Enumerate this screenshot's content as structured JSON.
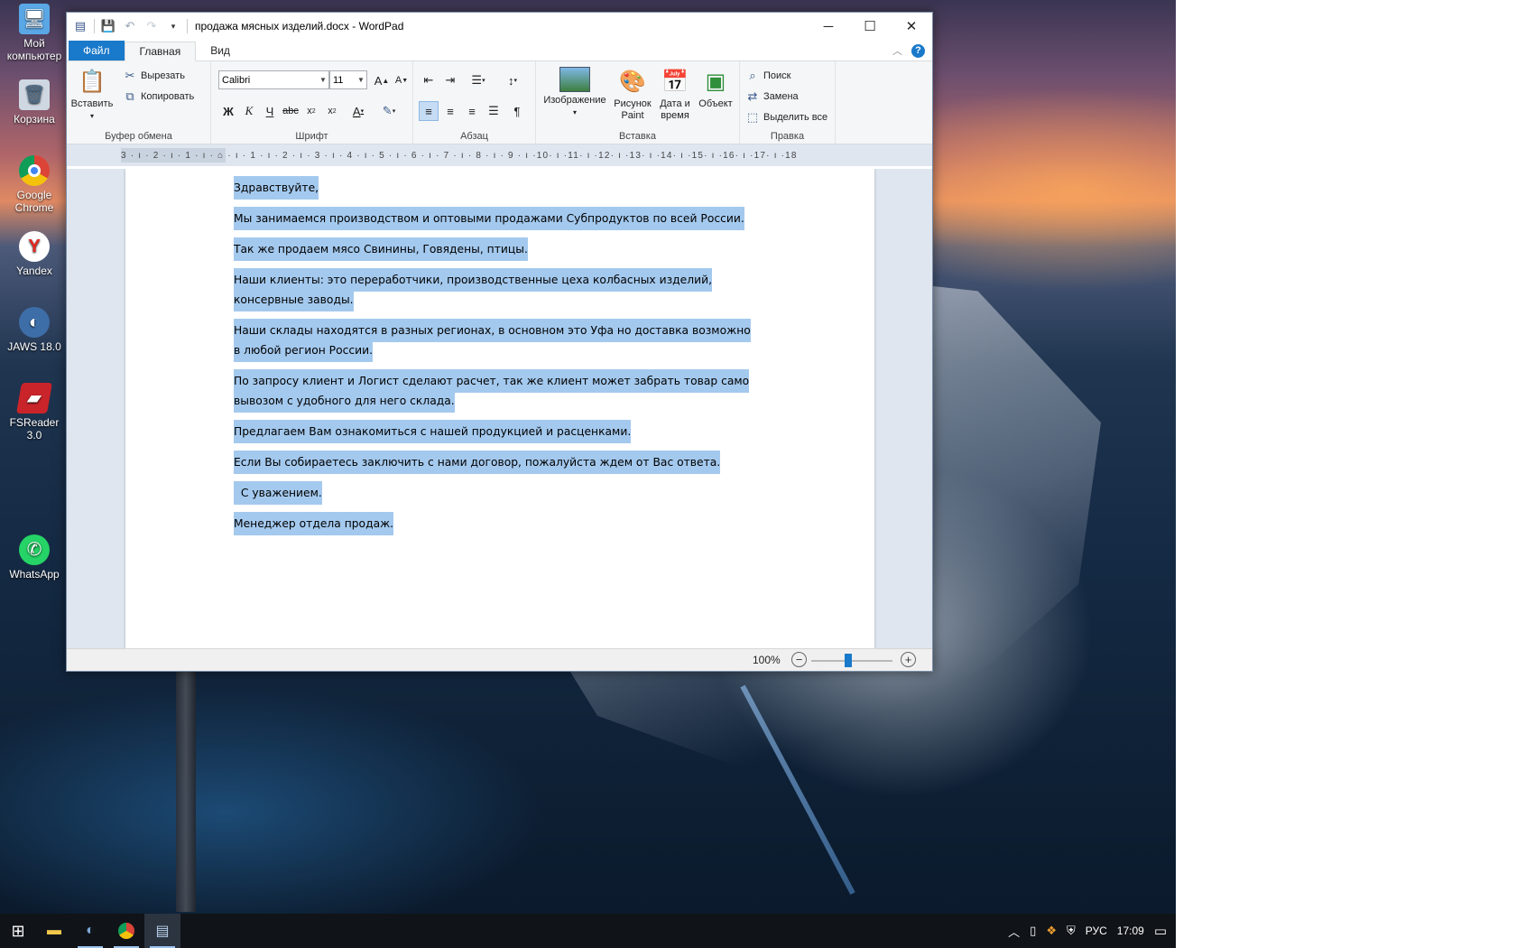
{
  "desktop": {
    "icons": [
      {
        "label": "Мой компьютер",
        "icon": "computer-icon"
      },
      {
        "label": "Корзина",
        "icon": "recycle-bin-icon"
      },
      {
        "label": "Google Chrome",
        "icon": "chrome-icon"
      },
      {
        "label": "Yandex",
        "icon": "yandex-icon"
      },
      {
        "label": "JAWS 18.0",
        "icon": "jaws-icon"
      },
      {
        "label": "FSReader 3.0",
        "icon": "fsreader-icon"
      },
      {
        "label": "WhatsApp",
        "icon": "whatsapp-icon"
      }
    ]
  },
  "window": {
    "title": "продажа мясных изделий.docx - WordPad",
    "tabs": {
      "file": "Файл",
      "home": "Главная",
      "view": "Вид"
    }
  },
  "ribbon": {
    "clipboard": {
      "paste": "Вставить",
      "cut": "Вырезать",
      "copy": "Копировать",
      "label": "Буфер обмена"
    },
    "font": {
      "name": "Calibri",
      "size": "11",
      "label": "Шрифт",
      "bold": "Ж",
      "italic": "К",
      "underline": "Ч",
      "strike": "abc"
    },
    "paragraph": {
      "label": "Абзац"
    },
    "insert": {
      "image": "Изображение",
      "paint_1": "Рисунок",
      "paint_2": "Paint",
      "datetime_1": "Дата и",
      "datetime_2": "время",
      "object": "Объект",
      "label": "Вставка"
    },
    "editing": {
      "find": "Поиск",
      "replace": "Замена",
      "select_all": "Выделить все",
      "label": "Правка"
    }
  },
  "ruler": {
    "text": "3 · ı · 2 · ı · 1 · ı · ⌂ · ı · 1 · ı · 2 · ı · 3 · ı · 4 · ı · 5 · ı · 6 · ı · 7 · ı · 8 · ı · 9 · ı ·10· ı ·11· ı ·12· ı ·13· ı ·14· ı ·15· ı ·16· ı ·17· ı ·18"
  },
  "document": {
    "paragraphs": [
      "Здравствуйте,",
      " Мы занимаемся производством и оптовыми продажами Субпродуктов по всей России.",
      " Так же продаем мясо Свинины, Говядены, птицы.",
      " Наши клиенты: это переработчики, производственные цеха колбасных изделий, консервные заводы.",
      " Наши склады находятся в разных регионах, в основном это Уфа но доставка возможно в любой регион России.",
      " По запросу клиент и Логист сделают расчет, так же клиент может забрать товар само вывозом с удобного для него склада.",
      "Предлагаем Вам ознакомиться с нашей продукцией и расценками.",
      " Если Вы собираетесь заключить с нами договор, пожалуйста ждем от Вас ответа.",
      "  С уважением.",
      " Менеджер отдела продаж."
    ]
  },
  "statusbar": {
    "zoom": "100%"
  },
  "taskbar": {
    "tray": {
      "lang": "РУС",
      "time": "17:09"
    }
  }
}
